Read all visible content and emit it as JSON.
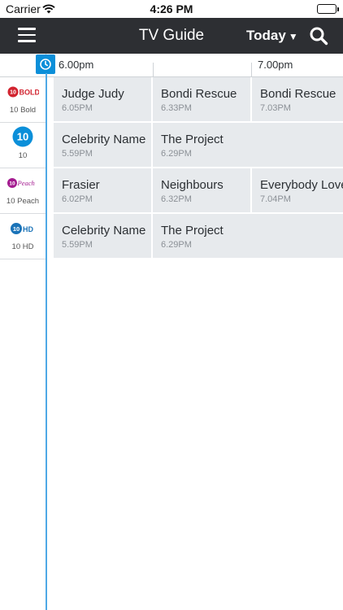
{
  "status_bar": {
    "carrier": "Carrier",
    "time": "4:26 PM"
  },
  "nav": {
    "title": "TV Guide",
    "today_label": "Today"
  },
  "ruler": {
    "times": [
      "6.00pm",
      "7.00pm"
    ]
  },
  "channels": [
    {
      "name": "10 Bold",
      "logo": "10 BOLD"
    },
    {
      "name": "10",
      "logo": "10"
    },
    {
      "name": "10 Peach",
      "logo": "10 Peach"
    },
    {
      "name": "10 HD",
      "logo": "10 HD"
    }
  ],
  "schedule": [
    [
      {
        "title": "Judge Judy",
        "time": "6.05PM"
      },
      {
        "title": "Bondi Rescue",
        "time": "6.33PM"
      },
      {
        "title": "Bondi Rescue",
        "time": "7.03PM"
      }
    ],
    [
      {
        "title": "Celebrity Name",
        "time": "5.59PM"
      },
      {
        "title": "The Project",
        "time": "6.29PM"
      }
    ],
    [
      {
        "title": "Frasier",
        "time": "6.02PM"
      },
      {
        "title": "Neighbours",
        "time": "6.32PM"
      },
      {
        "title": "Everybody Love",
        "time": "7.04PM"
      }
    ],
    [
      {
        "title": "Celebrity Name",
        "time": "5.59PM"
      },
      {
        "title": "The Project",
        "time": "6.29PM"
      }
    ]
  ],
  "colors": {
    "nav_bg": "#2d2f33",
    "accent": "#0b8fd9",
    "cell_bg": "#e7eaed",
    "bold_red": "#d2232f",
    "peach_purple": "#a31a8f",
    "ten_blue": "#0b8fd9"
  }
}
